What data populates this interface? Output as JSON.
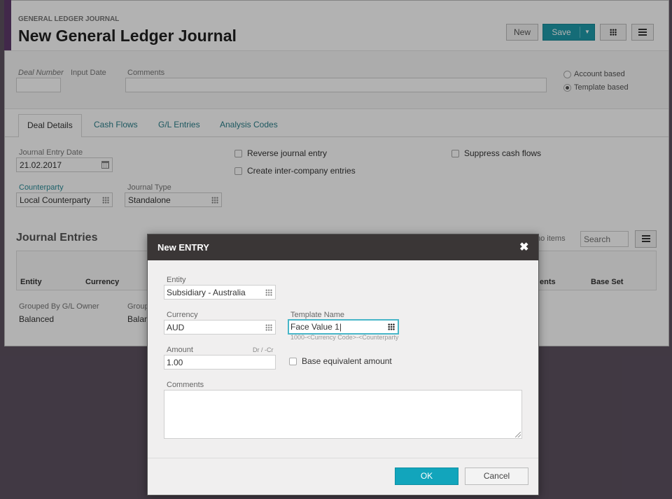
{
  "header": {
    "breadcrumb": "GENERAL LEDGER JOURNAL",
    "title": "New General Ledger Journal",
    "buttons": {
      "new": "New",
      "save": "Save"
    }
  },
  "top_form": {
    "deal_number_label": "Deal Number",
    "deal_number_value": "",
    "input_date_label": "Input Date",
    "comments_label": "Comments",
    "comments_value": "",
    "radios": [
      {
        "label": "Account based",
        "selected": false
      },
      {
        "label": "Template based",
        "selected": true
      }
    ]
  },
  "tabs": [
    {
      "label": "Deal Details",
      "active": true
    },
    {
      "label": "Cash Flows",
      "active": false
    },
    {
      "label": "G/L Entries",
      "active": false
    },
    {
      "label": "Analysis Codes",
      "active": false
    }
  ],
  "deal_details": {
    "journal_entry_date_label": "Journal Entry Date",
    "journal_entry_date_value": "21.02.2017",
    "counterparty_label": "Counterparty",
    "counterparty_value": "Local Counterparty",
    "journal_type_label": "Journal Type",
    "journal_type_value": "Standalone",
    "checkboxes": [
      {
        "label": "Reverse journal entry",
        "checked": false
      },
      {
        "label": "Create inter-company entries",
        "checked": false
      },
      {
        "label": "Suppress cash flows",
        "checked": false
      }
    ]
  },
  "journal_entries": {
    "title": "Journal Entries",
    "status_text": "no items",
    "search_placeholder": "Search",
    "columns": [
      "Entity",
      "Currency",
      "ents",
      "Base Set"
    ],
    "grouped_by_label": "Grouped By G/L Owner",
    "grouped_by_value": "Balanced",
    "group_label_2": "Group",
    "group_value_2": "Balan"
  },
  "modal": {
    "title": "New ENTRY",
    "entity_label": "Entity",
    "entity_value": "Subsidiary - Australia",
    "currency_label": "Currency",
    "currency_value": "AUD",
    "template_label": "Template Name",
    "template_value": "Face Value 1|",
    "template_hint": "1000-<Currency Code>-<Counterparty",
    "amount_label": "Amount",
    "amount_hint": "Dr / -Cr",
    "amount_value": "1.00",
    "base_equiv_label": "Base equivalent amount",
    "comments_label": "Comments",
    "comments_value": "",
    "ok_label": "OK",
    "cancel_label": "Cancel"
  },
  "colors": {
    "accent": "#5e3a6b",
    "save_button": "#1f9bab",
    "ok_button": "#12a5bc",
    "focus_border": "#48b6c8",
    "modal_header": "#3a3636"
  }
}
